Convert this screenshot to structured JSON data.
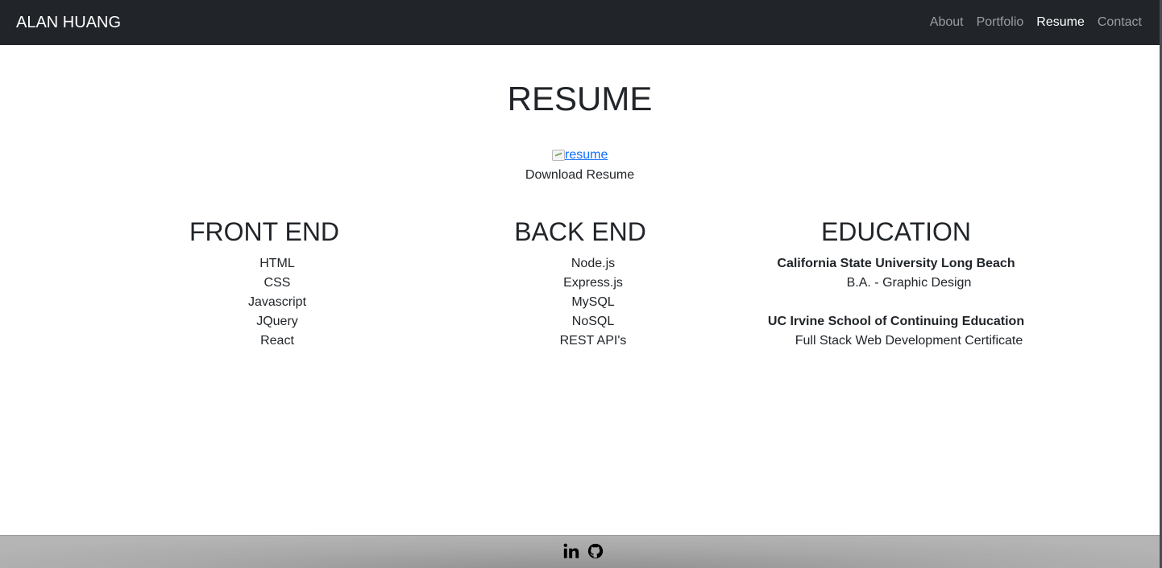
{
  "navbar": {
    "brand": "ALAN HUANG",
    "links": [
      {
        "label": "About"
      },
      {
        "label": "Portfolio"
      },
      {
        "label": "Resume"
      },
      {
        "label": "Contact"
      }
    ],
    "active": "Resume"
  },
  "main": {
    "title": "RESUME",
    "resume_image_alt": "resume",
    "download_label": "Download Resume"
  },
  "front_end": {
    "heading": "FRONT END",
    "items": [
      "HTML",
      "CSS",
      "Javascript",
      "JQuery",
      "React"
    ]
  },
  "back_end": {
    "heading": "BACK END",
    "items": [
      "Node.js",
      "Express.js",
      "MySQL",
      "NoSQL",
      "REST API's"
    ]
  },
  "education": {
    "heading": "EDUCATION",
    "entries": [
      {
        "school": "California State University Long Beach",
        "degree": "B.A. - Graphic Design"
      },
      {
        "school": "UC Irvine School of Continuing Education",
        "degree": "Full Stack Web Development Certificate"
      }
    ]
  },
  "footer": {
    "icons": [
      "linkedin-icon",
      "github-icon"
    ]
  },
  "colors": {
    "navbar_bg": "#212529",
    "nav_link": "#9a9da1",
    "nav_active": "#ffffff",
    "link_blue": "#0d6efd",
    "footer_bg": "#a9a9a9"
  }
}
